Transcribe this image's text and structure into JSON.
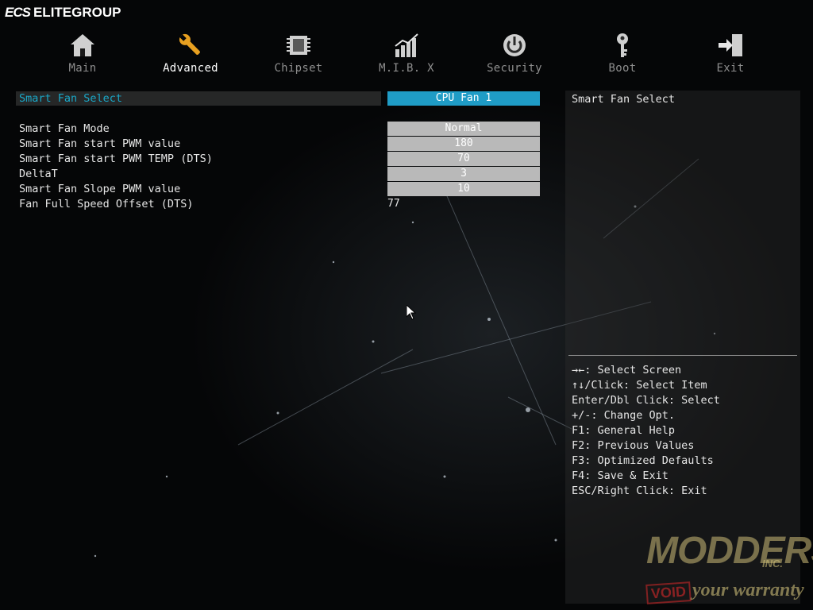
{
  "brand": {
    "logo": "ECS",
    "name": "ELITEGROUP"
  },
  "tabs": [
    {
      "label": "Main",
      "icon": "home-icon",
      "active": false
    },
    {
      "label": "Advanced",
      "icon": "wrench-icon",
      "active": true
    },
    {
      "label": "Chipset",
      "icon": "chip-icon",
      "active": false
    },
    {
      "label": "M.I.B. X",
      "icon": "chart-icon",
      "active": false
    },
    {
      "label": "Security",
      "icon": "power-icon",
      "active": false
    },
    {
      "label": "Boot",
      "icon": "key-icon",
      "active": false
    },
    {
      "label": "Exit",
      "icon": "exit-icon",
      "active": false
    }
  ],
  "settings": {
    "rows": [
      {
        "label": "Smart Fan Select",
        "value": "CPU Fan 1"
      },
      {
        "label": "Smart Fan Mode",
        "value": "Normal"
      },
      {
        "label": "Smart Fan start PWM value",
        "value": "180"
      },
      {
        "label": "Smart Fan start PWM TEMP (DTS)",
        "value": "70"
      },
      {
        "label": "DeltaT",
        "value": "3"
      },
      {
        "label": "Smart Fan Slope PWM value",
        "value": "10"
      },
      {
        "label": "Fan Full Speed Offset (DTS)",
        "value": "77"
      }
    ]
  },
  "help": {
    "title": "Smart Fan Select",
    "keys": [
      "→←: Select Screen",
      "↑↓/Click: Select Item",
      "Enter/Dbl Click: Select",
      "+/-: Change Opt.",
      "F1: General Help",
      "F2: Previous Values",
      "F3: Optimized Defaults",
      "F4: Save & Exit",
      "ESC/Right Click: Exit"
    ]
  },
  "watermark": {
    "main": "MODDERS",
    "inc": "INC.",
    "void": "VOID",
    "warranty": "your warranty"
  },
  "colors": {
    "accent": "#1f9cc6",
    "selected_text": "#1aa7c7",
    "value_box": "#b9b9b9",
    "background": "#050607"
  }
}
